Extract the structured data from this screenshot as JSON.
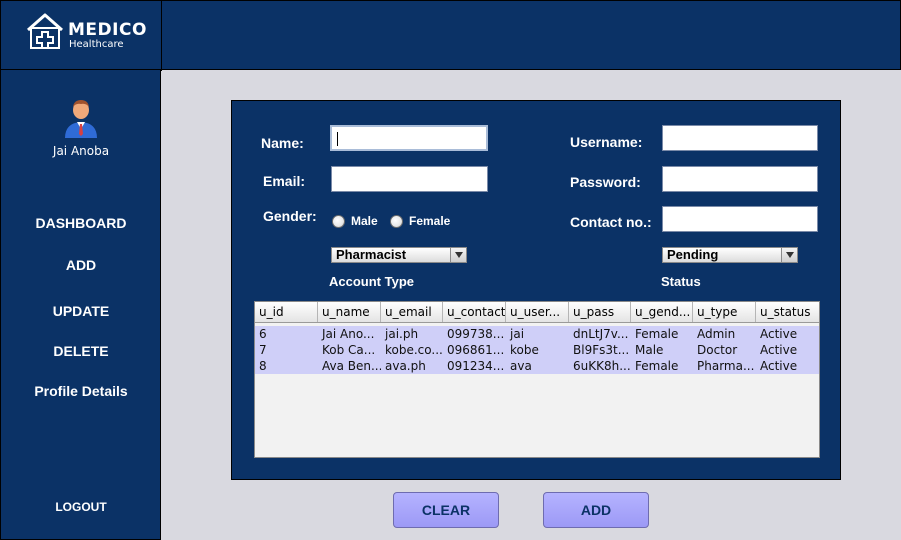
{
  "brand": {
    "title": "MEDICO",
    "subtitle": "Healthcare"
  },
  "user": {
    "name": "Jai Anoba"
  },
  "nav": [
    {
      "label": "DASHBOARD"
    },
    {
      "label": "ADD"
    },
    {
      "label": "UPDATE"
    },
    {
      "label": "DELETE"
    },
    {
      "label": "Profile Details"
    }
  ],
  "logout_label": "LOGOUT",
  "form": {
    "name_label": "Name:",
    "name_value": "",
    "email_label": "Email:",
    "email_value": "",
    "gender_label": "Gender:",
    "gender_options": [
      "Male",
      "Female"
    ],
    "username_label": "Username:",
    "username_value": "",
    "password_label": "Password:",
    "password_value": "",
    "contact_label": "Contact no.:",
    "contact_value": "",
    "account_type_selected": "Pharmacist",
    "account_type_caption": "Account Type",
    "status_selected": "Pending",
    "status_caption": "Status"
  },
  "table": {
    "columns": [
      "u_id",
      "u_name",
      "u_email",
      "u_contact",
      "u_user...",
      "u_pass",
      "u_gend...",
      "u_type",
      "u_status"
    ],
    "rows": [
      [
        "6",
        "Jai Ano...",
        "jai.ph",
        "099738...",
        "jai",
        "dnLtJ7v...",
        "Female",
        "Admin",
        "Active"
      ],
      [
        "7",
        "Kob Ca...",
        "kobe.co...",
        "096861...",
        "kobe",
        "Bl9Fs3t...",
        "Male",
        "Doctor",
        "Active"
      ],
      [
        "8",
        "Ava Ben...",
        "ava.ph",
        "091234...",
        "ava",
        "6uKK8h...",
        "Female",
        "Pharma...",
        "Active"
      ]
    ]
  },
  "buttons": {
    "clear": "CLEAR",
    "add": "ADD"
  },
  "colors": {
    "navy": "#0b3266",
    "background": "#d9d9e0",
    "row_highlight": "#cfcff8",
    "button": "#a9a7fb"
  }
}
